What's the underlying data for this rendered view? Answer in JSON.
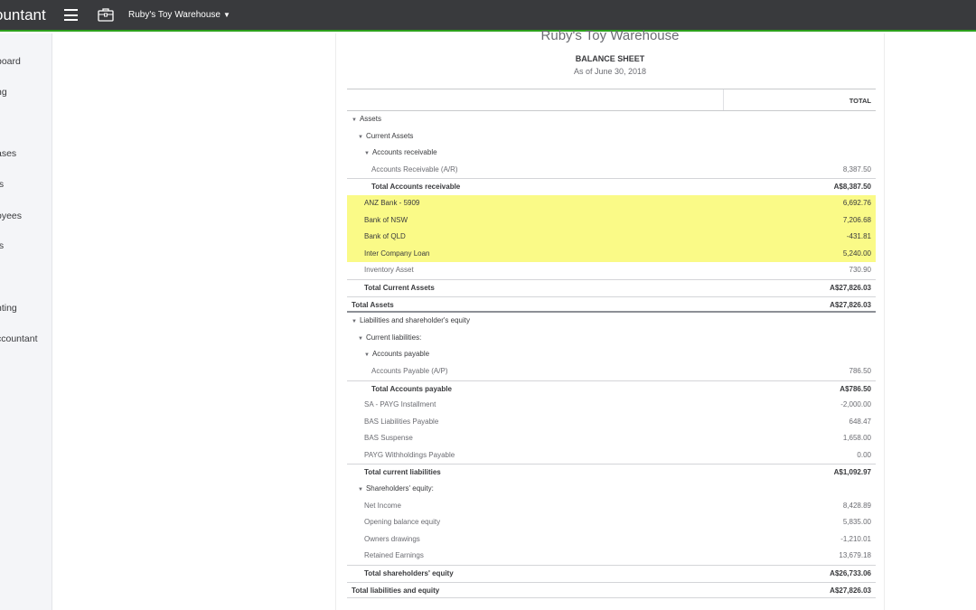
{
  "app": {
    "title": "ountant",
    "company": "Ruby's Toy Warehouse"
  },
  "sidebar": {
    "items": [
      {
        "label": "board"
      },
      {
        "label": "ng"
      },
      {
        "label": "ases"
      },
      {
        "label": "ts"
      },
      {
        "label": "oyees"
      },
      {
        "label": "ts"
      },
      {
        "label": "nting"
      },
      {
        "label": "ccountant"
      }
    ]
  },
  "report": {
    "company": "Ruby's Toy Warehouse",
    "title": "BALANCE SHEET",
    "date": "As of June 30, 2018",
    "column": "TOTAL",
    "rows": [
      {
        "label": "Assets",
        "amount": ""
      },
      {
        "label": "Current Assets",
        "amount": ""
      },
      {
        "label": "Accounts receivable",
        "amount": ""
      },
      {
        "label": "Accounts Receivable (A/R)",
        "amount": "8,387.50"
      },
      {
        "label": "Total Accounts receivable",
        "amount": "A$8,387.50"
      },
      {
        "label": "ANZ Bank - 5909",
        "amount": "6,692.76"
      },
      {
        "label": "Bank of NSW",
        "amount": "7,206.68"
      },
      {
        "label": "Bank of QLD",
        "amount": "-431.81"
      },
      {
        "label": "Inter Company Loan",
        "amount": "5,240.00"
      },
      {
        "label": "Inventory Asset",
        "amount": "730.90"
      },
      {
        "label": "Total Current Assets",
        "amount": "A$27,826.03"
      },
      {
        "label": "Total Assets",
        "amount": "A$27,826.03"
      },
      {
        "label": "Liabilities and shareholder's equity",
        "amount": ""
      },
      {
        "label": "Current liabilities:",
        "amount": ""
      },
      {
        "label": "Accounts payable",
        "amount": ""
      },
      {
        "label": "Accounts Payable (A/P)",
        "amount": "786.50"
      },
      {
        "label": "Total Accounts payable",
        "amount": "A$786.50"
      },
      {
        "label": "SA - PAYG Installment",
        "amount": "-2,000.00"
      },
      {
        "label": "BAS Liabilities Payable",
        "amount": "648.47"
      },
      {
        "label": "BAS Suspense",
        "amount": "1,658.00"
      },
      {
        "label": "PAYG Withholdings Payable",
        "amount": "0.00"
      },
      {
        "label": "Total current liabilities",
        "amount": "A$1,092.97"
      },
      {
        "label": "Shareholders' equity:",
        "amount": ""
      },
      {
        "label": "Net Income",
        "amount": "8,428.89"
      },
      {
        "label": "Opening balance equity",
        "amount": "5,835.00"
      },
      {
        "label": "Owners drawings",
        "amount": "-1,210.01"
      },
      {
        "label": "Retained Earnings",
        "amount": "13,679.18"
      },
      {
        "label": "Total shareholders' equity",
        "amount": "A$26,733.06"
      },
      {
        "label": "Total liabilities and equity",
        "amount": "A$27,826.03"
      }
    ]
  },
  "colors": {
    "topbar": "#393a3d",
    "accent": "#2ca01c",
    "highlight": "#fafa87"
  },
  "icons": {
    "menu": "hamburger-icon",
    "briefcase": "briefcase-icon",
    "expand": "triangle-down-icon"
  }
}
